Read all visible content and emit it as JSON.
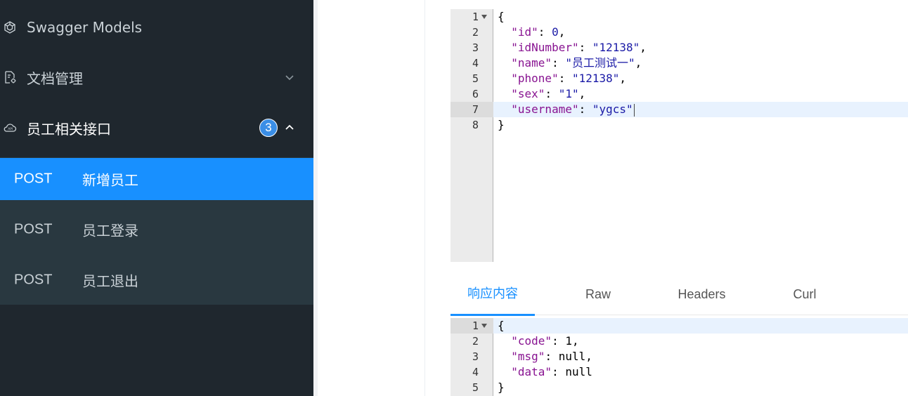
{
  "sidebar": {
    "swagger_models": {
      "label": "Swagger Models",
      "icon": "swagger-models-icon"
    },
    "doc_manage": {
      "label": "文档管理",
      "icon": "document-settings-icon"
    },
    "employee_group": {
      "label": "员工相关接口",
      "badge": "3",
      "icon": "cloud-api-icon"
    },
    "items": [
      {
        "method": "POST",
        "label": "新增员工",
        "selected": true
      },
      {
        "method": "POST",
        "label": "员工登录",
        "selected": false
      },
      {
        "method": "POST",
        "label": "员工退出",
        "selected": false
      }
    ]
  },
  "request_editor": {
    "lines": [
      {
        "n": "1",
        "text": "{"
      },
      {
        "n": "2",
        "key": "\"id\"",
        "value": "0",
        "suffix": ","
      },
      {
        "n": "3",
        "key": "\"idNumber\"",
        "value": "\"12138\"",
        "suffix": ","
      },
      {
        "n": "4",
        "key": "\"name\"",
        "value": "\"员工测试一\"",
        "suffix": ","
      },
      {
        "n": "5",
        "key": "\"phone\"",
        "value": "\"12138\"",
        "suffix": ","
      },
      {
        "n": "6",
        "key": "\"sex\"",
        "value": "\"1\"",
        "suffix": ","
      },
      {
        "n": "7",
        "key": "\"username\"",
        "value": "\"ygcs\"",
        "suffix": ""
      },
      {
        "n": "8",
        "text": "}"
      }
    ]
  },
  "response_tabs": [
    "响应内容",
    "Raw",
    "Headers",
    "Curl"
  ],
  "response_editor": {
    "lines": [
      {
        "n": "1",
        "text": "{"
      },
      {
        "n": "2",
        "key": "\"code\"",
        "value": "1",
        "suffix": ","
      },
      {
        "n": "3",
        "key": "\"msg\"",
        "value": "null",
        "suffix": ","
      },
      {
        "n": "4",
        "key": "\"data\"",
        "value": "null",
        "suffix": ""
      },
      {
        "n": "5",
        "text": "}"
      }
    ]
  },
  "colors": {
    "sidebar_bg": "#1f272e",
    "submenu_bg": "#293840",
    "accent": "#1890ff",
    "json_key": "#881391",
    "json_value": "#1a1aa6"
  }
}
